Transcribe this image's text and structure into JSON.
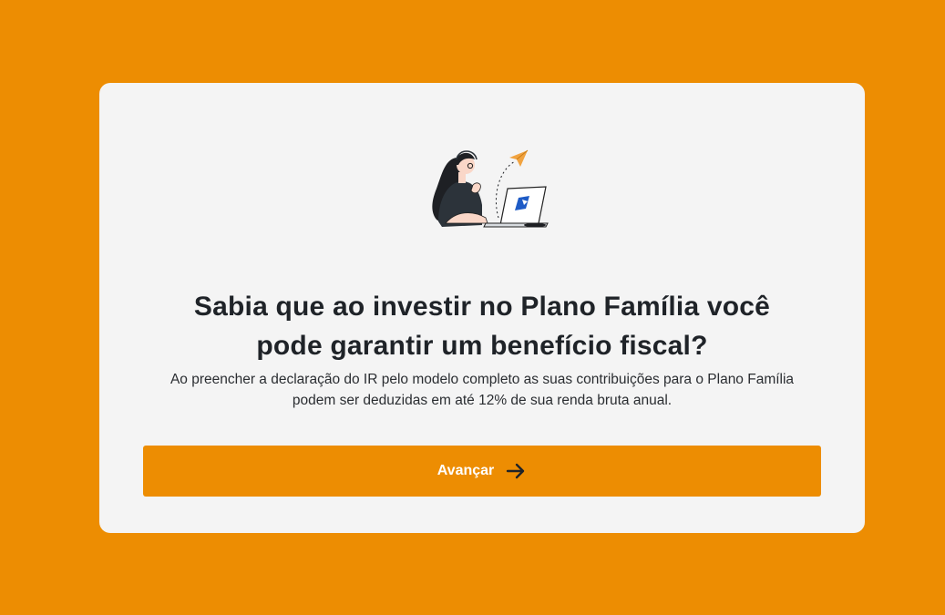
{
  "colors": {
    "page_background": "#ED8D02",
    "card_background": "#F4F4F4",
    "accent": "#ED8D02",
    "text_primary": "#1F2328",
    "button_text": "#FFFFFF"
  },
  "card": {
    "illustration_icon": "woman-with-laptop-illustration",
    "title_line1": "Sabia que ao investir no Plano Família você",
    "title_line2": "pode garantir um benefício fiscal?",
    "description_line1": "Ao preencher a declaração do IR pelo modelo completo as suas contribuições para o Plano Família",
    "description_line2": "podem ser deduzidas em até 12% de sua renda bruta anual.",
    "next_button": {
      "label": "Avançar",
      "icon": "arrow-right-icon"
    }
  }
}
